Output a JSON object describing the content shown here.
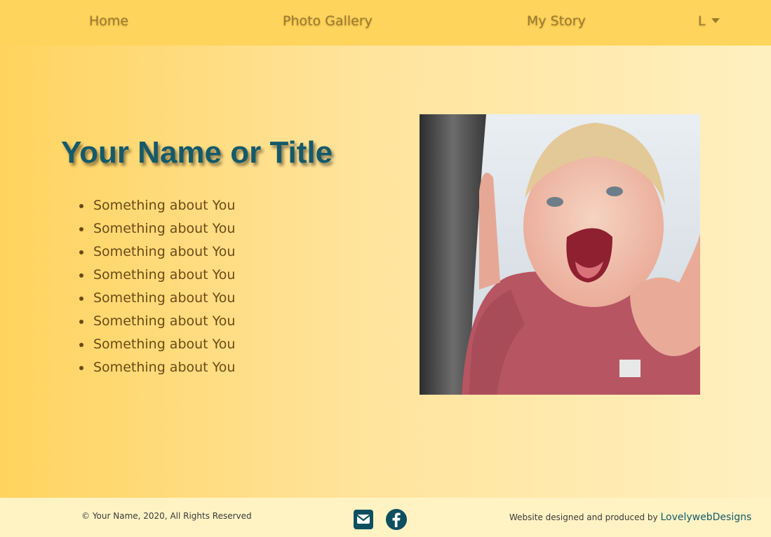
{
  "nav": {
    "home": "Home",
    "gallery": "Photo Gallery",
    "story": "My Story",
    "dropdown": "L"
  },
  "hero": {
    "title": "Your Name or Title",
    "items": [
      "Something about You",
      "Something about You",
      "Something about You",
      "Something about You",
      "Something about You",
      "Something about You",
      "Something about You",
      "Something about You"
    ],
    "photo_icon": "child-photo"
  },
  "footer": {
    "copyright": "© Your Name, 2020, All Rights Reserved",
    "credit_prefix": "Website designed and produced by",
    "credit_link": "LovelywebDesigns",
    "social_icons": [
      "email-icon",
      "facebook-icon"
    ]
  },
  "colors": {
    "navbar": "#ffd45c",
    "title": "#145a6a",
    "text": "#6b4a17",
    "footer": "#fff3c4"
  }
}
